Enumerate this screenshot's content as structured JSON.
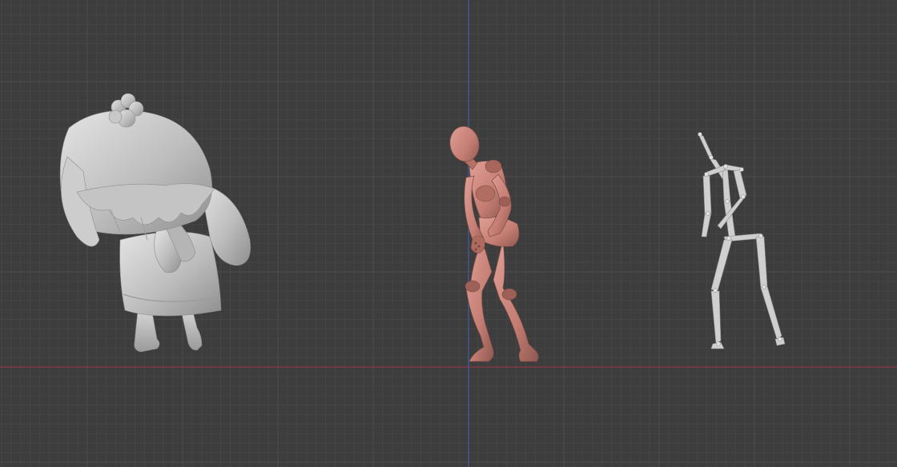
{
  "viewport": {
    "view": "front-orthographic",
    "grid_visible": true,
    "colors": {
      "background": "#3d3d3d",
      "grid_minor": "#454545",
      "grid_major": "#4d4d4d",
      "axis_x": "#8a3a44",
      "axis_z": "#3f5f9a"
    },
    "objects": [
      {
        "name": "chibi-character",
        "kind": "mesh",
        "shading": "solid",
        "color": "#c9c9c9"
      },
      {
        "name": "mannequin",
        "kind": "mesh",
        "shading": "solid",
        "color": "#c9837a"
      },
      {
        "name": "armature",
        "kind": "armature",
        "display": "octahedral",
        "color": "#cfcfcf"
      }
    ]
  }
}
